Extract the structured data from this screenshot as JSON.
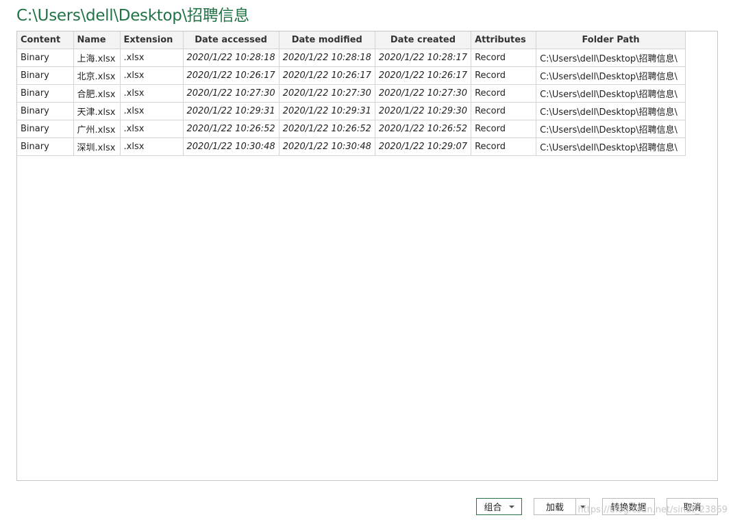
{
  "title": "C:\\Users\\dell\\Desktop\\招聘信息",
  "table": {
    "columns": [
      "Content",
      "Name",
      "Extension",
      "Date accessed",
      "Date modified",
      "Date created",
      "Attributes",
      "Folder Path"
    ],
    "rows": [
      [
        "Binary",
        "上海.xlsx",
        ".xlsx",
        "2020/1/22 10:28:18",
        "2020/1/22 10:28:18",
        "2020/1/22 10:28:17",
        "Record",
        "C:\\Users\\dell\\Desktop\\招聘信息\\"
      ],
      [
        "Binary",
        "北京.xlsx",
        ".xlsx",
        "2020/1/22 10:26:17",
        "2020/1/22 10:26:17",
        "2020/1/22 10:26:17",
        "Record",
        "C:\\Users\\dell\\Desktop\\招聘信息\\"
      ],
      [
        "Binary",
        "合肥.xlsx",
        ".xlsx",
        "2020/1/22 10:27:30",
        "2020/1/22 10:27:30",
        "2020/1/22 10:27:30",
        "Record",
        "C:\\Users\\dell\\Desktop\\招聘信息\\"
      ],
      [
        "Binary",
        "天津.xlsx",
        ".xlsx",
        "2020/1/22 10:29:31",
        "2020/1/22 10:29:31",
        "2020/1/22 10:29:30",
        "Record",
        "C:\\Users\\dell\\Desktop\\招聘信息\\"
      ],
      [
        "Binary",
        "广州.xlsx",
        ".xlsx",
        "2020/1/22 10:26:52",
        "2020/1/22 10:26:52",
        "2020/1/22 10:26:52",
        "Record",
        "C:\\Users\\dell\\Desktop\\招聘信息\\"
      ],
      [
        "Binary",
        "深圳.xlsx",
        ".xlsx",
        "2020/1/22 10:30:48",
        "2020/1/22 10:30:48",
        "2020/1/22 10:29:07",
        "Record",
        "C:\\Users\\dell\\Desktop\\招聘信息\\"
      ]
    ]
  },
  "buttons": {
    "combine": "组合",
    "load": "加载",
    "transform": "转换数据",
    "cancel": "取消"
  },
  "icons": {
    "combine_dropdown": "chevron-down-icon",
    "load_dropdown": "chevron-down-icon"
  },
  "watermark": "https://blog.csdn.net/sinat_23869",
  "colors": {
    "accent": "#217346",
    "header_bg": "#f3f3f3",
    "grid_line": "#d4d4d4"
  }
}
